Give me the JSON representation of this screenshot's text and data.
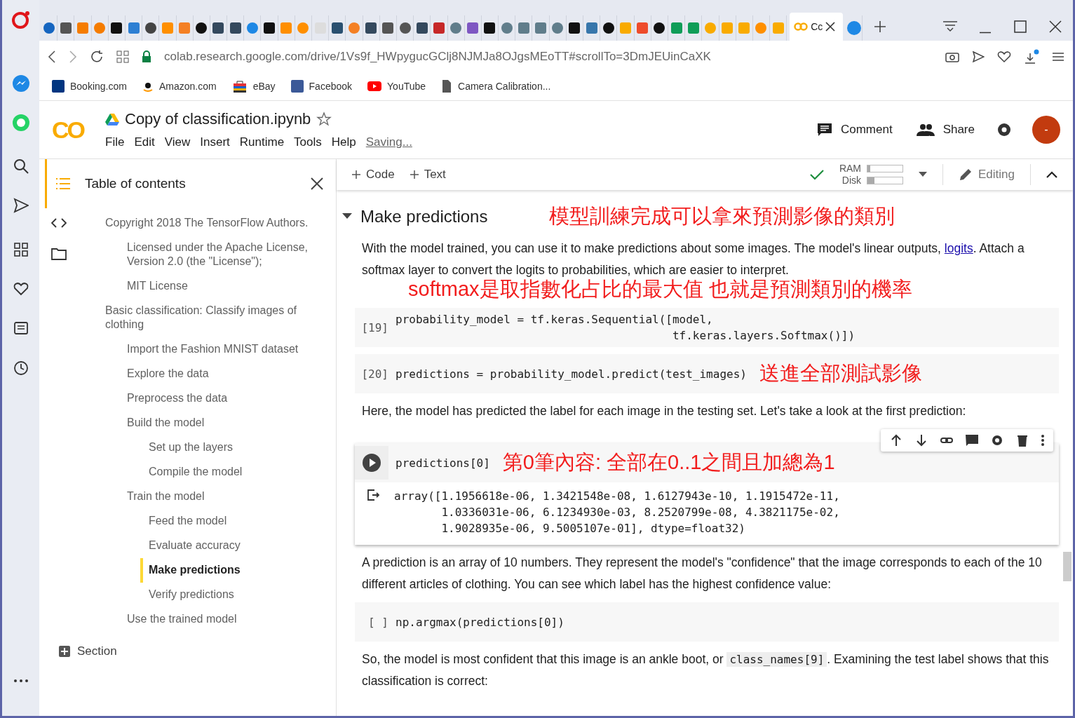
{
  "browser": {
    "active_tab": {
      "title": "Cc",
      "selected": true
    },
    "address": "colab.research.google.com/drive/1Vs9f_HWpygucGClj8NJMJa8OJgsMEoTT#scrollTo=3DmJEUinCaXK",
    "bookmarks": [
      {
        "label": "Booking.com",
        "kind": "booking"
      },
      {
        "label": "Amazon.com",
        "kind": "amazon"
      },
      {
        "label": "eBay",
        "kind": "ebay"
      },
      {
        "label": "Facebook",
        "kind": "facebook"
      },
      {
        "label": "YouTube",
        "kind": "youtube"
      },
      {
        "label": "Camera Calibration...",
        "kind": "page"
      }
    ]
  },
  "colab": {
    "logo": "CO",
    "title": "Copy of classification.ipynb",
    "menu": [
      "File",
      "Edit",
      "View",
      "Insert",
      "Runtime",
      "Tools",
      "Help"
    ],
    "status": "Saving...",
    "actions": [
      {
        "label": "Comment",
        "kind": "comment"
      },
      {
        "label": "Share",
        "kind": "share"
      }
    ],
    "avatar": "-",
    "toolbar": {
      "add": [
        "Code",
        "Text"
      ],
      "ram": {
        "label": "RAM",
        "level": 0.08
      },
      "disk": {
        "label": "Disk",
        "level": 0.2
      },
      "mode": "Editing"
    }
  },
  "toc": {
    "title": "Table of contents",
    "items": [
      {
        "label": "Copyright 2018 The TensorFlow Authors.",
        "selected": false,
        "children": [
          {
            "label": "Licensed under the Apache License, Version 2.0 (the \"License\");",
            "selected": false
          },
          {
            "label": "MIT License",
            "selected": false
          }
        ]
      },
      {
        "label": "Basic classification: Classify images of clothing",
        "selected": false,
        "children": [
          {
            "label": "Import the Fashion MNIST dataset",
            "selected": false
          },
          {
            "label": "Explore the data",
            "selected": false
          },
          {
            "label": "Preprocess the data",
            "selected": false
          },
          {
            "label": "Build the model",
            "selected": false,
            "children": [
              {
                "label": "Set up the layers",
                "selected": false
              },
              {
                "label": "Compile the model",
                "selected": false
              }
            ]
          },
          {
            "label": "Train the model",
            "selected": false,
            "children": [
              {
                "label": "Feed the model",
                "selected": false
              },
              {
                "label": "Evaluate accuracy",
                "selected": false
              },
              {
                "label": "Make predictions",
                "selected": true
              },
              {
                "label": "Verify predictions",
                "selected": false
              }
            ]
          },
          {
            "label": "Use the trained model",
            "selected": false
          }
        ]
      }
    ],
    "add_section": "Section"
  },
  "cells": [
    {
      "kind": "heading",
      "text": "Make predictions",
      "note": "模型訓練完成可以拿來預測影像的類別"
    },
    {
      "kind": "text",
      "parts": [
        {
          "text": "With the model trained, you can use it to make predictions about some images. The model's linear outputs, "
        },
        {
          "text": "logits",
          "link": true
        },
        {
          "text": ". Attach a softmax layer to convert the logits to probabilities, which are easier to interpret."
        }
      ],
      "note": "softmax是取指數化占比的最大值 也就是預測類別的機率"
    },
    {
      "kind": "code",
      "prompt": "[19]",
      "active": false,
      "lines": [
        "probability_model = tf.keras.Sequential([model,",
        "                                         tf.keras.layers.Softmax()])"
      ]
    },
    {
      "kind": "code",
      "prompt": "[20]",
      "active": false,
      "lines": [
        "predictions = probability_model.predict(test_images)"
      ],
      "note": "送進全部測試影像"
    },
    {
      "kind": "text",
      "parts": [
        {
          "text": "Here, the model has predicted the label for each image in the testing set. Let's take a look at the first prediction:"
        }
      ]
    },
    {
      "kind": "code",
      "active": true,
      "lines": [
        "predictions[0]"
      ],
      "note": "第0筆內容: 全部在0..1之間且加總為1",
      "output": [
        "array([1.1956618e-06, 1.3421548e-08, 1.6127943e-10, 1.1915472e-11,",
        "       1.0336031e-06, 6.1234930e-03, 8.2520799e-08, 4.3821175e-02,",
        "       1.9028935e-06, 9.5005107e-01], dtype=float32)"
      ]
    },
    {
      "kind": "text",
      "parts": [
        {
          "text": "A prediction is an array of 10 numbers. They represent the model's \"confidence\" that the image corresponds to each of the 10 different articles of clothing. You can see which label has the highest confidence value:"
        }
      ]
    },
    {
      "kind": "code",
      "prompt": "[ ]",
      "active": false,
      "lines": [
        "np.argmax(predictions[0])"
      ]
    },
    {
      "kind": "text",
      "parts": [
        {
          "text": "So, the model is most confident that this image is an ankle boot, or "
        },
        {
          "text": "class_names[9]",
          "code": true
        },
        {
          "text": ". Examining the test label shows that this classification is correct:"
        }
      ]
    }
  ]
}
